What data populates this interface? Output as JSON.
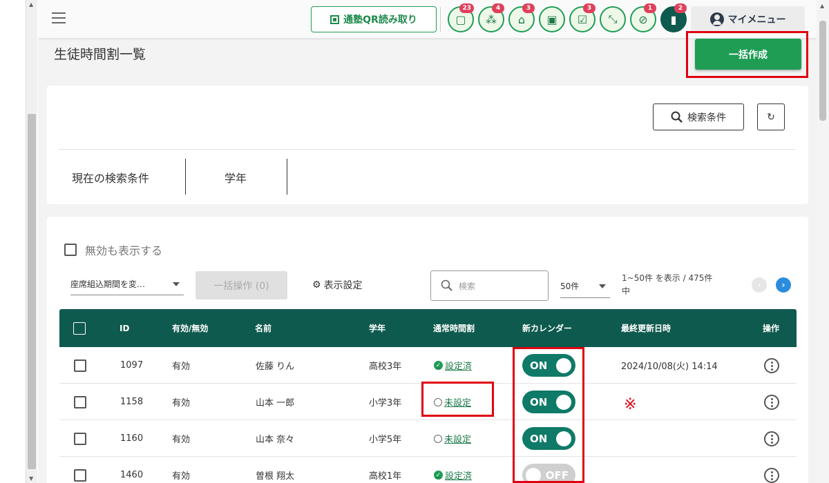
{
  "header": {
    "qr_button": "通塾QR読み取り",
    "icons": [
      {
        "name": "chat-icon",
        "glyph": "▢",
        "badge": "23"
      },
      {
        "name": "group-icon",
        "glyph": "⁂",
        "badge": "4"
      },
      {
        "name": "school-icon",
        "glyph": "⌂",
        "badge": "3"
      },
      {
        "name": "gift-icon",
        "glyph": "▣",
        "badge": ""
      },
      {
        "name": "checklist-icon",
        "glyph": "☑",
        "badge": "3"
      },
      {
        "name": "shrink-arrows-icon",
        "glyph": "⤡",
        "badge": ""
      },
      {
        "name": "location-off-icon",
        "glyph": "⊘",
        "badge": "1"
      },
      {
        "name": "message-icon",
        "glyph": "▮",
        "badge": "2"
      }
    ],
    "my_menu": "マイメニュー"
  },
  "page": {
    "title": "生徒時間割一覧",
    "bulk_create": "一括作成"
  },
  "search_card": {
    "search_conditions_button": "検索条件",
    "refresh_icon": "↻",
    "current_conditions_label": "現在の検索条件",
    "condition_grade": "学年"
  },
  "list_controls": {
    "show_invalid": "無効も表示する",
    "period_select": "座席組込期間を変…",
    "bulk_operation": "一括操作 (0)",
    "display_settings": "表示設定",
    "search_placeholder": "検索",
    "per_page": "50件",
    "range_line1": "1~50件 を表示 / 475件",
    "range_line2": "中",
    "prev": "‹",
    "next": "›"
  },
  "table": {
    "headers": {
      "id": "ID",
      "active": "有効/無効",
      "name": "名前",
      "grade": "学年",
      "timetable": "通常時間割",
      "new_calendar": "新カレンダー",
      "updated": "最終更新日時",
      "ops": "操作"
    },
    "rows": [
      {
        "id": "1097",
        "active": "有効",
        "name": "佐藤 りん",
        "grade": "高校3年",
        "timetable": "設定済",
        "timetable_set": true,
        "calendar": "ON",
        "updated": "2024/10/08(火) 14:14"
      },
      {
        "id": "1158",
        "active": "有効",
        "name": "山本 一郎",
        "grade": "小学3年",
        "timetable": "未設定",
        "timetable_set": false,
        "calendar": "ON",
        "updated": ""
      },
      {
        "id": "1160",
        "active": "有効",
        "name": "山本 奈々",
        "grade": "小学5年",
        "timetable": "未設定",
        "timetable_set": false,
        "calendar": "ON",
        "updated": ""
      },
      {
        "id": "1460",
        "active": "有効",
        "name": "曽根 翔太",
        "grade": "高校1年",
        "timetable": "設定済",
        "timetable_set": true,
        "calendar": "OFF",
        "updated": ""
      }
    ]
  },
  "annotation": {
    "note_mark": "※"
  },
  "colors": {
    "primary_green": "#1f9d55",
    "header_teal": "#0f5a4e",
    "toggle_on": "#0f7a68",
    "highlight_red": "#e00010",
    "badge_red": "#e0405a"
  }
}
